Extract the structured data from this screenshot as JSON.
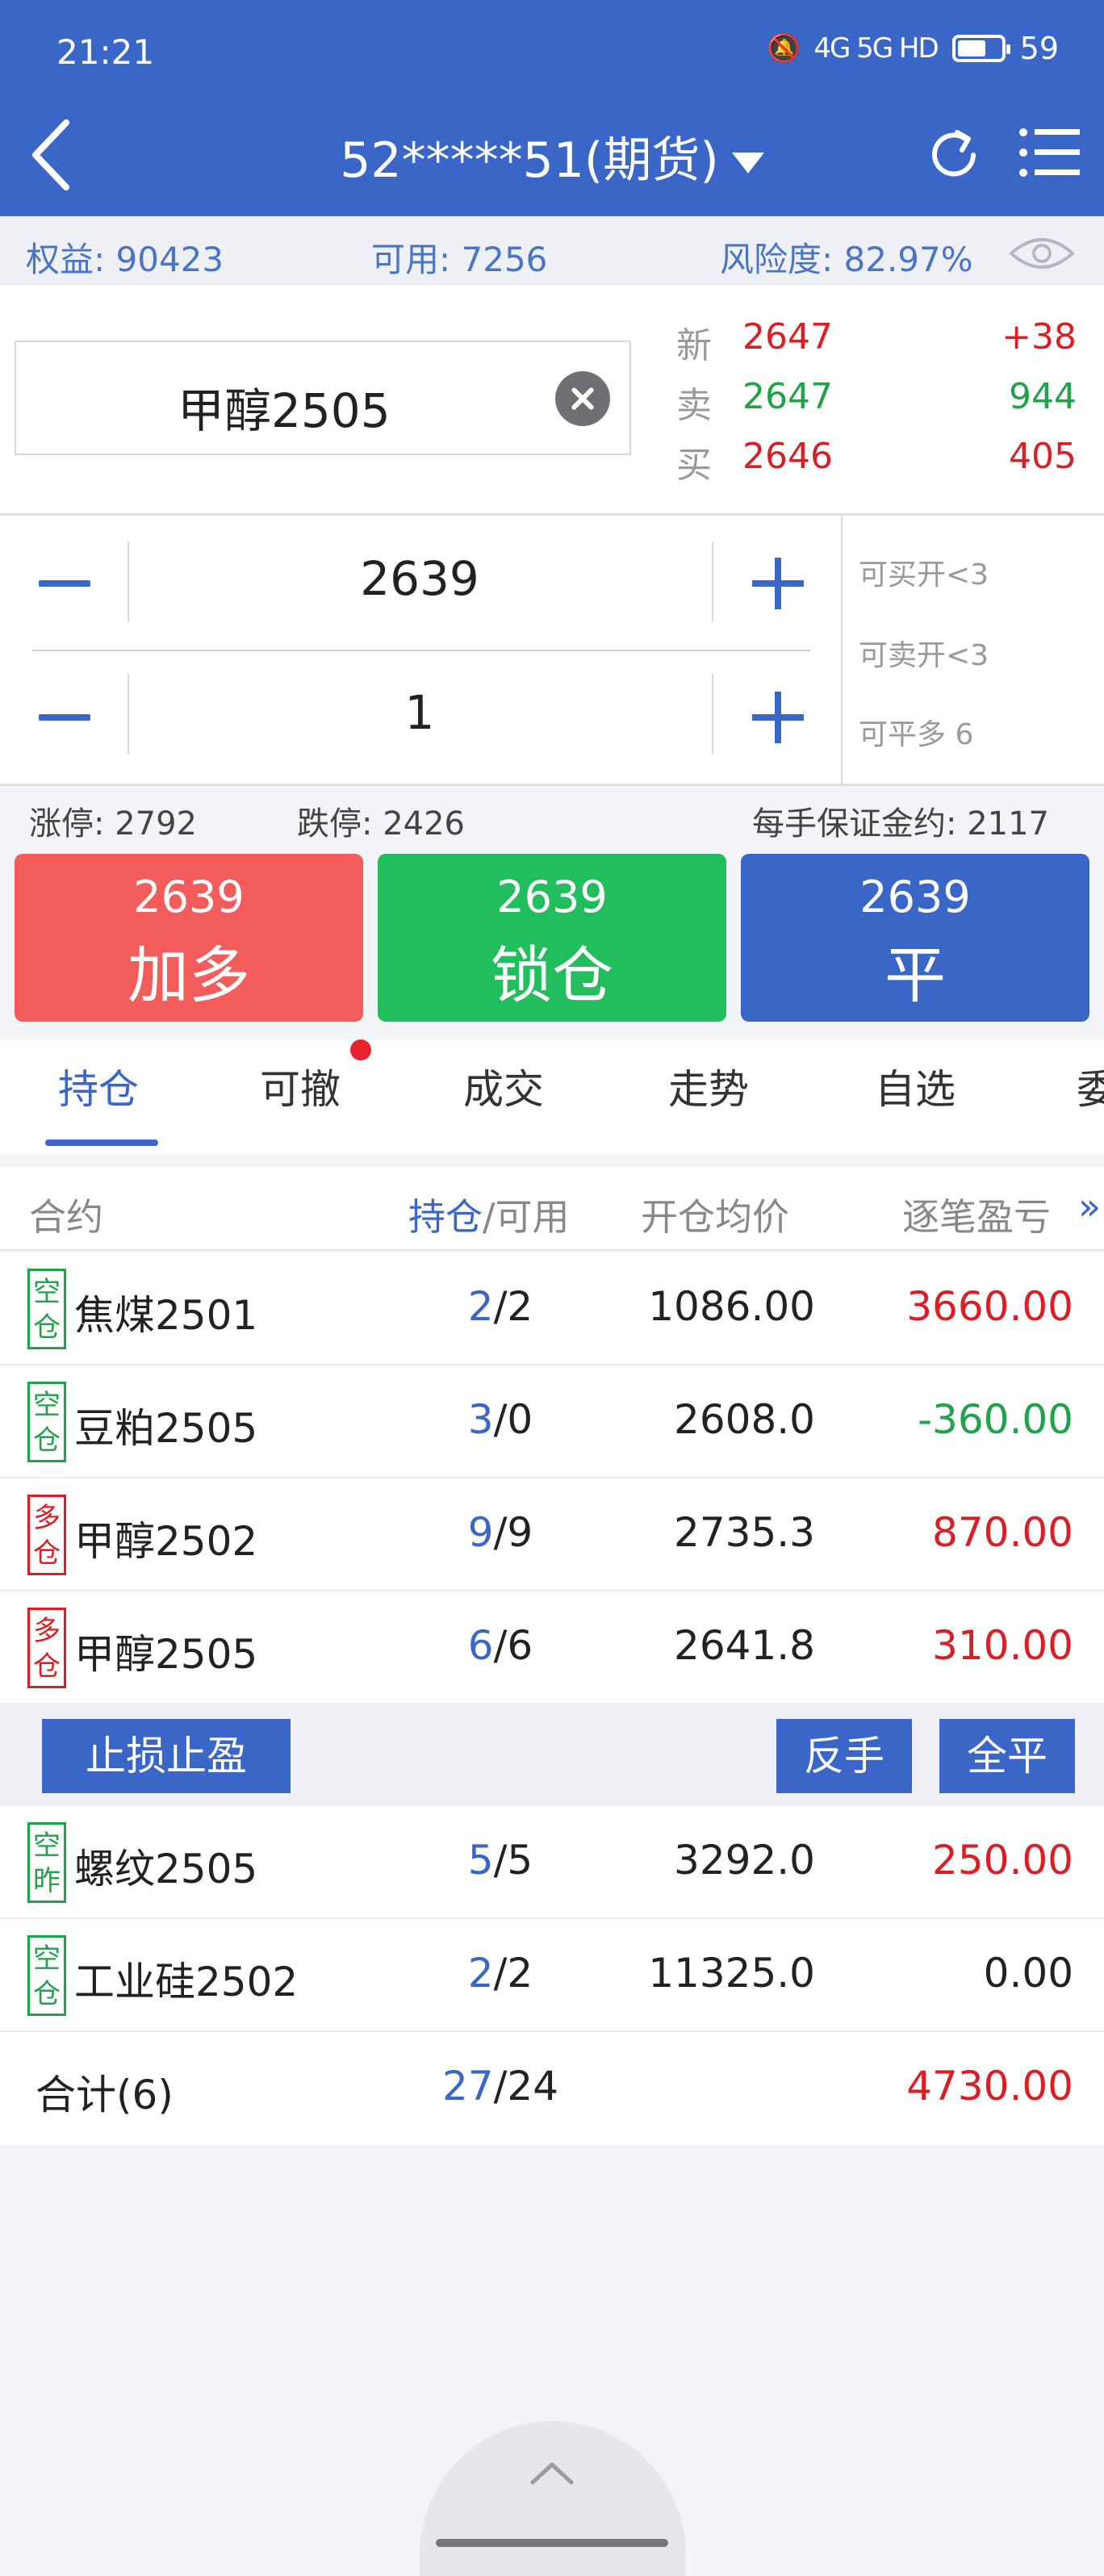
{
  "status_bar": {
    "time": "21:21",
    "network": "4G 5G HD",
    "battery": "59"
  },
  "header": {
    "title": "52*****51(期货)"
  },
  "account": {
    "equity": "权益: 90423",
    "available": "可用: 7256",
    "risk": "风险度: 82.97%"
  },
  "contract": {
    "name": "甲醇2505"
  },
  "quote": {
    "last_label": "新",
    "last_price": "2647",
    "last_change": "+38",
    "ask_label": "卖",
    "ask_price": "2647",
    "ask_volume": "944",
    "bid_label": "买",
    "bid_price": "2646",
    "bid_volume": "405"
  },
  "order": {
    "price": "2639",
    "quantity": "1",
    "can_buy_open": "可买开<3",
    "can_sell_open": "可卖开<3",
    "can_close_long": "可平多 6"
  },
  "limits": {
    "upper": "涨停: 2792",
    "lower": "跌停: 2426",
    "margin": "每手保证金约: 2117"
  },
  "buttons": {
    "buy": {
      "price": "2639",
      "label": "加多",
      "color": "#f25d5b"
    },
    "lock": {
      "price": "2639",
      "label": "锁仓",
      "color": "#22bd5d"
    },
    "close": {
      "price": "2639",
      "label": "平",
      "color": "#3a66c8"
    }
  },
  "tabs": [
    "持仓",
    "可撤",
    "成交",
    "走势",
    "自选",
    "委"
  ],
  "table": {
    "headers": {
      "contract": "合约",
      "position": "持仓",
      "available": "/可用",
      "avg_price": "开仓均价",
      "pnl": "逐笔盈亏",
      "more": "»"
    },
    "rows_top": [
      {
        "tag1": "空",
        "tag2": "仓",
        "side": "short",
        "name": "焦煤2501",
        "pos": "2",
        "avail": "/2",
        "price": "1086.00",
        "pnl": "3660.00",
        "pnl_color": "red"
      },
      {
        "tag1": "空",
        "tag2": "仓",
        "side": "short",
        "name": "豆粕2505",
        "pos": "3",
        "avail": "/0",
        "price": "2608.0",
        "pnl": "-360.00",
        "pnl_color": "green"
      },
      {
        "tag1": "多",
        "tag2": "仓",
        "side": "long",
        "name": "甲醇2502",
        "pos": "9",
        "avail": "/9",
        "price": "2735.3",
        "pnl": "870.00",
        "pnl_color": "red"
      },
      {
        "tag1": "多",
        "tag2": "仓",
        "side": "long",
        "name": "甲醇2505",
        "pos": "6",
        "avail": "/6",
        "price": "2641.8",
        "pnl": "310.00",
        "pnl_color": "red"
      }
    ],
    "actions": {
      "stop": "止损止盈",
      "reverse": "反手",
      "close_all": "全平"
    },
    "rows_bottom": [
      {
        "tag1": "空",
        "tag2": "昨",
        "side": "short",
        "name": "螺纹2505",
        "pos": "5",
        "avail": "/5",
        "price": "3292.0",
        "pnl": "250.00",
        "pnl_color": "red"
      },
      {
        "tag1": "空",
        "tag2": "仓",
        "side": "short",
        "name": "工业硅2502",
        "pos": "2",
        "avail": "/2",
        "price": "11325.0",
        "pnl": "0.00",
        "pnl_color": "black"
      }
    ],
    "total": {
      "label": "合计(6)",
      "pos": "27",
      "avail": "/24",
      "pnl": "4730.00"
    }
  }
}
